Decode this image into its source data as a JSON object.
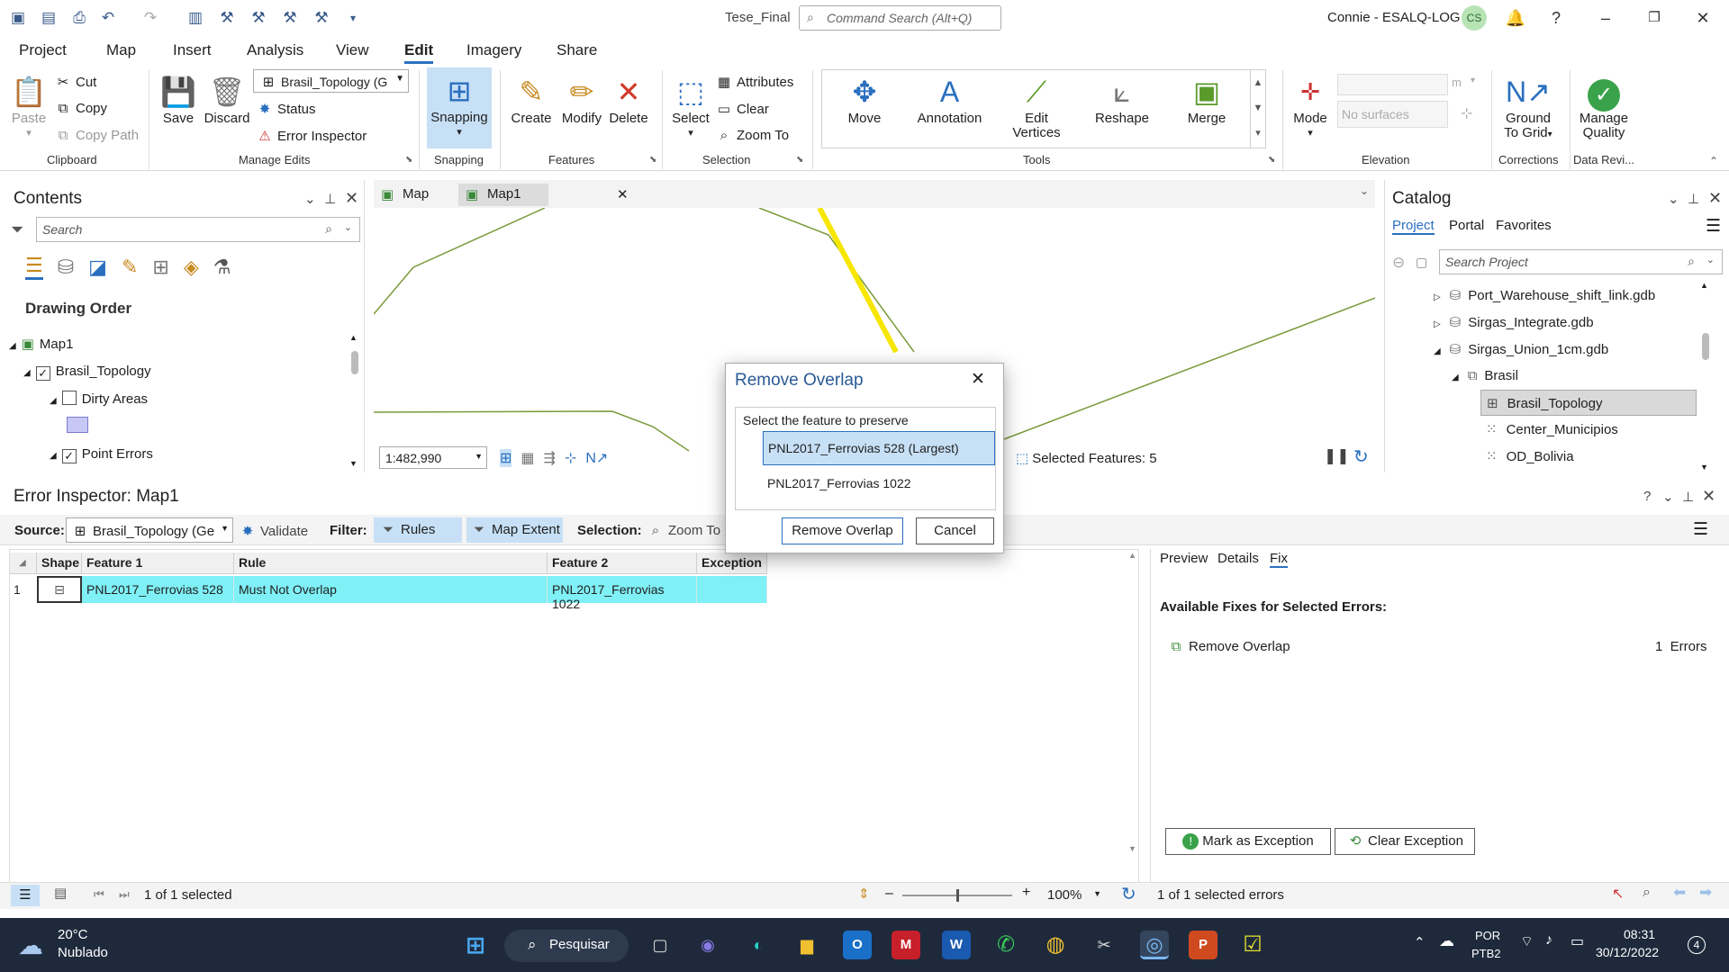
{
  "titlebar": {
    "doc_title": "Tese_Final",
    "command_search": "Command Search (Alt+Q)",
    "user": "Connie - ESALQ-LOG",
    "user_initials": "CS"
  },
  "menu_tabs": [
    "Project",
    "Map",
    "Insert",
    "Analysis",
    "View",
    "Edit",
    "Imagery",
    "Share"
  ],
  "ribbon": {
    "clipboard": {
      "paste": "Paste",
      "cut": "Cut",
      "copy": "Copy",
      "copy_path": "Copy Path",
      "label": "Clipboard"
    },
    "manage_edits": {
      "save": "Save",
      "discard": "Discard",
      "topology": "Brasil_Topology (G",
      "status": "Status",
      "error_inspector": "Error Inspector",
      "label": "Manage Edits"
    },
    "snapping": {
      "button": "Snapping",
      "label": "Snapping"
    },
    "features": {
      "create": "Create",
      "modify": "Modify",
      "delete": "Delete",
      "label": "Features"
    },
    "selection": {
      "select": "Select",
      "attributes": "Attributes",
      "clear": "Clear",
      "zoom_to": "Zoom To",
      "label": "Selection"
    },
    "tools": {
      "move": "Move",
      "annotation": "Annotation",
      "edit_vertices_1": "Edit",
      "edit_vertices_2": "Vertices",
      "reshape": "Reshape",
      "merge": "Merge",
      "label": "Tools"
    },
    "elevation": {
      "mode": "Mode",
      "unit": "m",
      "no_surfaces": "No surfaces",
      "label": "Elevation"
    },
    "corrections": {
      "ground_1": "Ground",
      "ground_2": "To Grid",
      "label": "Corrections"
    },
    "data_review": {
      "manage_1": "Manage",
      "manage_2": "Quality",
      "label": "Data Revi..."
    }
  },
  "contents": {
    "title": "Contents",
    "search_placeholder": "Search",
    "drawing_order": "Drawing Order",
    "items": [
      {
        "label": "Map1"
      },
      {
        "label": "Brasil_Topology",
        "checked": true
      },
      {
        "label": "Dirty Areas",
        "checked": false
      },
      {
        "label": "Point Errors",
        "checked": true
      }
    ]
  },
  "map": {
    "tabs": [
      "Map",
      "Map1"
    ],
    "scale": "1:482,990",
    "selected_features": "Selected Features: 5"
  },
  "catalog": {
    "title": "Catalog",
    "tabs": [
      "Project",
      "Portal",
      "Favorites"
    ],
    "search_placeholder": "Search Project",
    "items": [
      {
        "label": "Port_Warehouse_shift_link.gdb"
      },
      {
        "label": "Sirgas_Integrate.gdb"
      },
      {
        "label": "Sirgas_Union_1cm.gdb"
      },
      {
        "label": "Brasil"
      },
      {
        "label": "Brasil_Topology"
      },
      {
        "label": "Center_Municipios"
      },
      {
        "label": "OD_Bolivia"
      }
    ]
  },
  "error_inspector": {
    "title": "Error Inspector: Map1",
    "source_label": "Source:",
    "source_value": "Brasil_Topology (Ge",
    "validate": "Validate",
    "filter_label": "Filter:",
    "rules": "Rules",
    "map_extent": "Map Extent",
    "selection_label": "Selection:",
    "zoom_to": "Zoom To",
    "columns": [
      "Shape",
      "Feature 1",
      "Rule",
      "Feature 2",
      "Exception"
    ],
    "rows": [
      {
        "num": "1",
        "feature1": "PNL2017_Ferrovias 528",
        "rule": "Must Not Overlap",
        "feature2": "PNL2017_Ferrovias 1022",
        "exception": ""
      }
    ],
    "footer": "1 of 1 selected",
    "zoom": "100%",
    "panel_tabs": [
      "Preview",
      "Details",
      "Fix"
    ],
    "fixes_heading": "Available Fixes for Selected Errors:",
    "fix_name": "Remove Overlap",
    "fix_count": "1  Errors",
    "mark_exception": "Mark as Exception",
    "clear_exception": "Clear Exception",
    "errors_footer": "1 of 1 selected errors"
  },
  "dialog": {
    "title": "Remove Overlap",
    "prompt": "Select the feature to preserve",
    "options": [
      "PNL2017_Ferrovias 528 (Largest)",
      "PNL2017_Ferrovias 1022"
    ],
    "ok": "Remove Overlap",
    "cancel": "Cancel"
  },
  "taskbar": {
    "temp": "20°C",
    "weather": "Nublado",
    "search": "Pesquisar",
    "lang1": "POR",
    "lang2": "PTB2",
    "time": "08:31",
    "date": "30/12/2022",
    "notifications": "4"
  },
  "colors": {
    "accent": "#2a6fbf",
    "selected_row": "#7ff0f6",
    "map_line": "#7a9a3a",
    "highlight": "#f6e600"
  }
}
